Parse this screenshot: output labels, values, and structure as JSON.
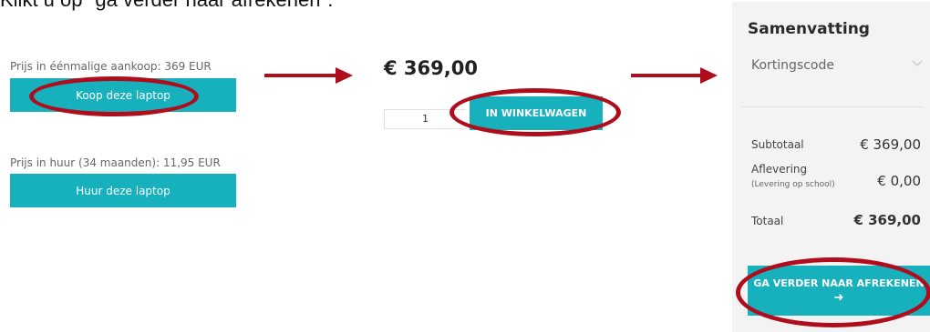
{
  "instruction": "Klikt u op \"ga verder naar afrekenen\".",
  "purchase": {
    "price_label": "Prijs in éénmalige aankoop: 369 EUR",
    "button_label": "Koop deze laptop"
  },
  "rent": {
    "price_label": "Prijs in huur (34 maanden): 11,95 EUR",
    "button_label": "Huur deze laptop"
  },
  "product": {
    "price": "€ 369,00",
    "quantity": "1",
    "add_to_cart_label": "IN WINKELWAGEN"
  },
  "summary": {
    "title": "Samenvatting",
    "discount_label": "Kortingscode",
    "subtotal_label": "Subtotaal",
    "subtotal_value": "€ 369,00",
    "delivery_label": "Aflevering",
    "delivery_note": "(Levering op school)",
    "delivery_value": "€ 0,00",
    "total_label": "Totaal",
    "total_value": "€ 369,00",
    "checkout_label": "GA VERDER NAAR AFREKENEN",
    "checkout_arrow": "➜"
  },
  "colors": {
    "accent": "#17b0bd",
    "highlight": "#b00d1c",
    "summary_bg": "#f3f3f3"
  }
}
